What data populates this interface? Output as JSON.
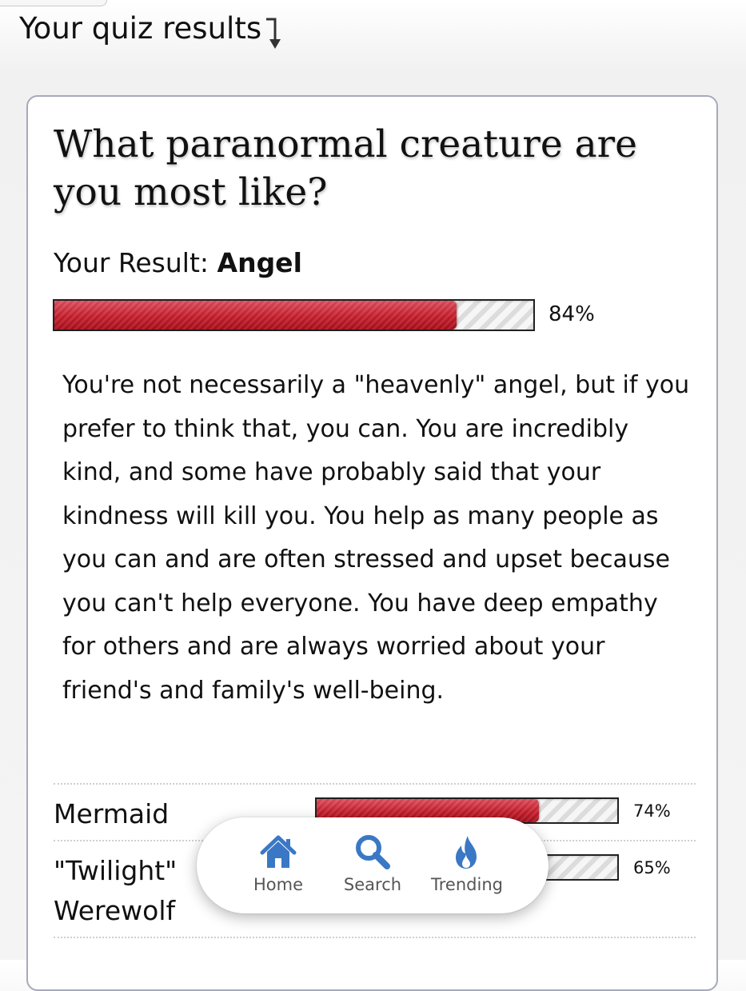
{
  "header": {
    "title": "Your quiz results"
  },
  "quiz": {
    "title": "What paranormal creature are you most like?",
    "result_label": "Your Result:",
    "result_name": "Angel",
    "result_percent_text": "84%",
    "result_percent": 84,
    "description": "You're not necessarily a \"heavenly\" angel, but if you prefer to think that, you can. You are incredibly kind, and some have probably said that your kindness will kill you. You help as many people as you can and are often stressed and upset because you can't help everyone. You have deep empathy for others and are always worried about your friend's and family's well-being.",
    "other_results": [
      {
        "name": "Mermaid",
        "percent_text": "74%",
        "percent": 74
      },
      {
        "name": "\"Twilight\" Werewolf",
        "percent_text": "65%",
        "percent": 65
      }
    ]
  },
  "nav": {
    "items": [
      {
        "label": "Home",
        "icon": "home-icon"
      },
      {
        "label": "Search",
        "icon": "search-icon"
      },
      {
        "label": "Trending",
        "icon": "flame-icon"
      }
    ]
  },
  "colors": {
    "bar_fill": "#c8202e",
    "nav_icon": "#3a78c6",
    "card_border": "#a7a9bd"
  }
}
